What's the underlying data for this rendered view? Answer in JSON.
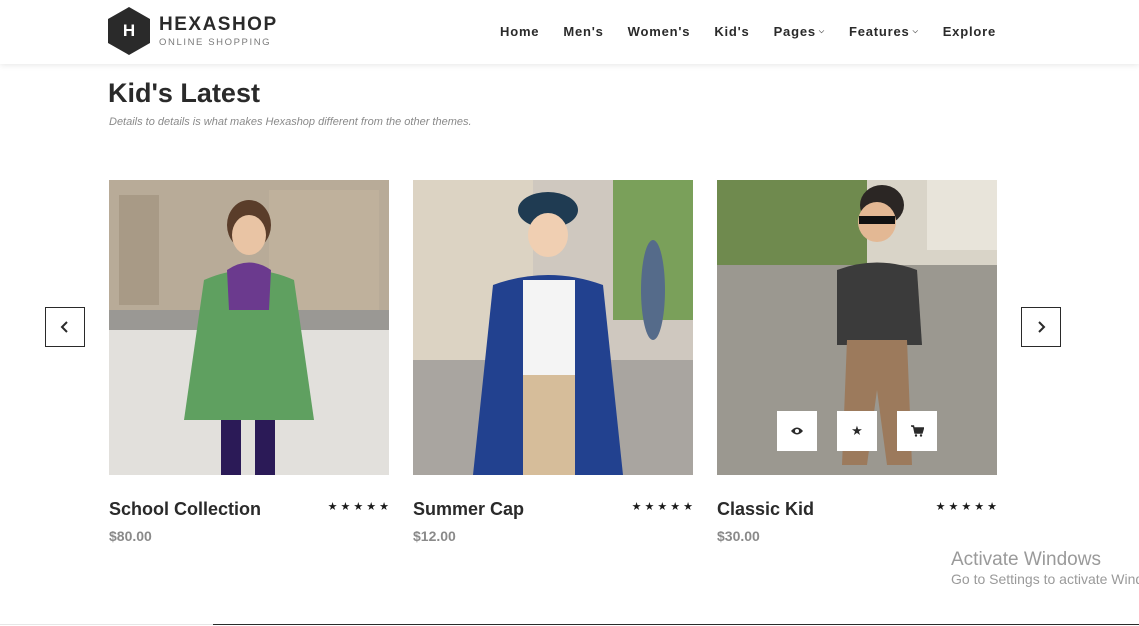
{
  "brand": {
    "initial": "H",
    "title": "HEXASHOP",
    "subtitle": "ONLINE SHOPPING"
  },
  "nav": {
    "items": [
      {
        "label": "Home",
        "dropdown": false
      },
      {
        "label": "Men's",
        "dropdown": false
      },
      {
        "label": "Women's",
        "dropdown": false
      },
      {
        "label": "Kid's",
        "dropdown": false
      },
      {
        "label": "Pages",
        "dropdown": true
      },
      {
        "label": "Features",
        "dropdown": true
      },
      {
        "label": "Explore",
        "dropdown": false
      }
    ]
  },
  "section": {
    "title": "Kid's Latest",
    "subtitle": "Details to details is what makes Hexashop different from the other themes."
  },
  "carousel": {
    "prev_icon": "chevron-left-icon",
    "next_icon": "chevron-right-icon",
    "products": [
      {
        "name": "School Collection",
        "price": "$80.00",
        "rating": 5
      },
      {
        "name": "Summer Cap",
        "price": "$12.00",
        "rating": 5
      },
      {
        "name": "Classic Kid",
        "price": "$30.00",
        "rating": 5
      }
    ],
    "hover_actions": [
      "eye-icon",
      "star-icon",
      "cart-icon"
    ]
  },
  "watermark": {
    "line1": "Activate Windows",
    "line2": "Go to Settings to activate Windows."
  },
  "colors": {
    "dark": "#2a2a2a",
    "price": "#8a8a8a",
    "accent_bg": "#ffffff"
  }
}
